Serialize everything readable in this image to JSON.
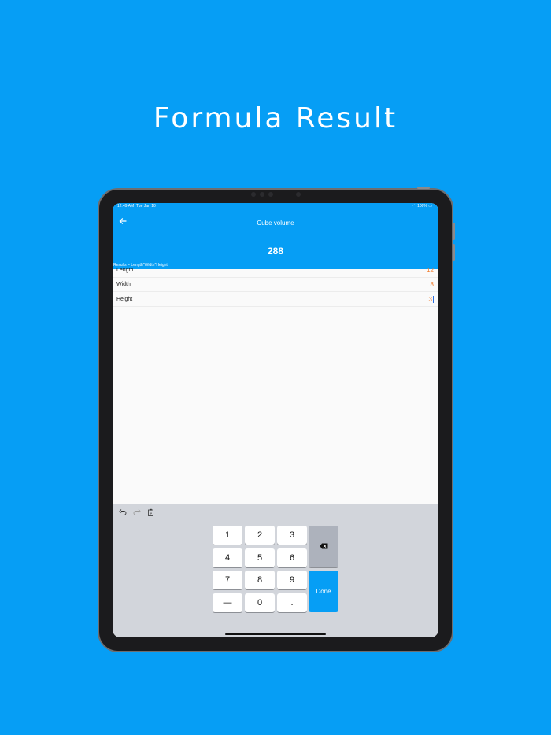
{
  "headline": "Formula Result",
  "status": {
    "time": "12:49 AM",
    "date": "Tue Jan 10",
    "battery": "100%"
  },
  "app": {
    "title": "Cube volume",
    "back_icon": "arrow-left-icon",
    "result": "288",
    "formula": "Results = Length*Width*Height"
  },
  "fields": [
    {
      "label": "Length",
      "value": "12"
    },
    {
      "label": "Width",
      "value": "8"
    },
    {
      "label": "Height",
      "value": "3"
    }
  ],
  "keyboard": {
    "tools": [
      "undo-icon",
      "redo-icon",
      "paste-icon"
    ],
    "keys": [
      "1",
      "2",
      "3",
      "4",
      "5",
      "6",
      "7",
      "8",
      "9",
      "—",
      "0",
      "."
    ],
    "backspace_icon": "backspace-icon",
    "done_label": "Done"
  },
  "colors": {
    "accent": "#069ef5",
    "value": "#f07a2a",
    "keyboard_bg": "#d2d5db"
  }
}
